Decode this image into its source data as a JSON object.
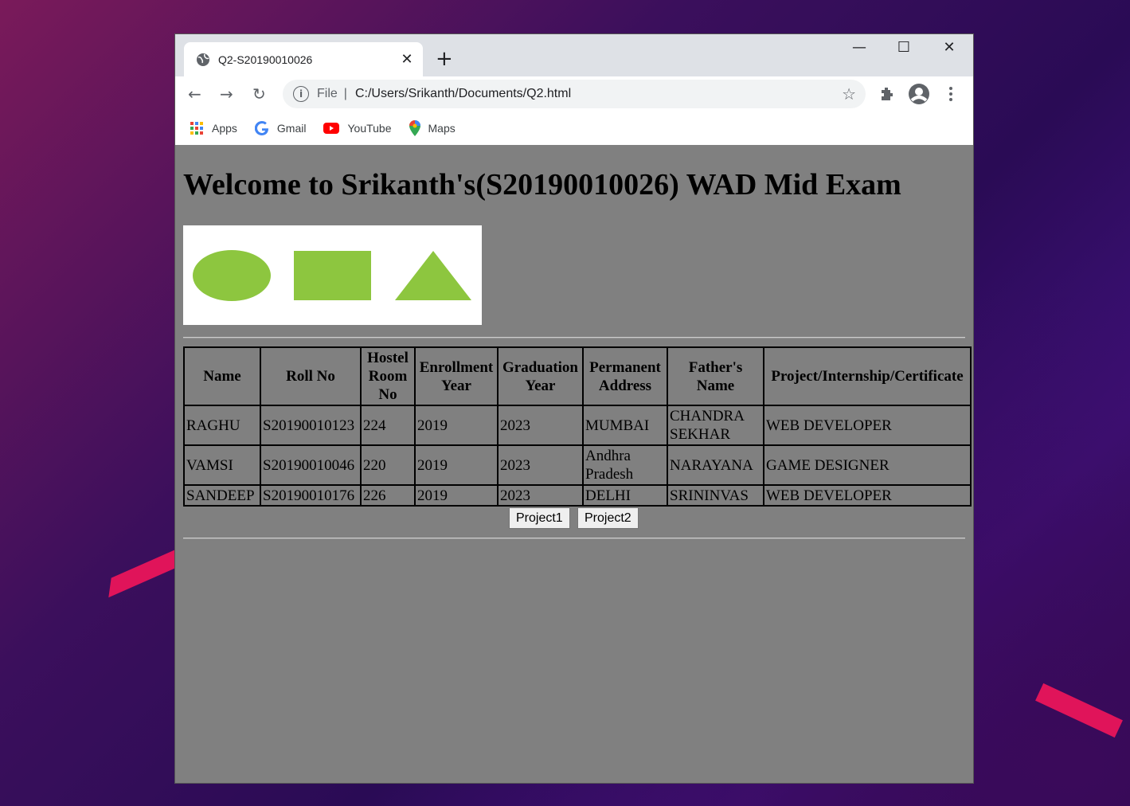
{
  "browser": {
    "tab_title": "Q2-S20190010026",
    "tab_close": "✕",
    "new_tab": "+",
    "window_controls": {
      "minimize": "—",
      "maximize": "☐",
      "close": "✕"
    },
    "nav": {
      "back": "←",
      "forward": "→",
      "reload": "↻"
    },
    "address": {
      "info_glyph": "i",
      "scheme": "File",
      "separator": "|",
      "url": "C:/Users/Srikanth/Documents/Q2.html"
    },
    "bookmarks": [
      {
        "label": "Apps",
        "icon": "apps-grid-icon"
      },
      {
        "label": "Gmail",
        "icon": "google-icon"
      },
      {
        "label": "YouTube",
        "icon": "youtube-icon"
      },
      {
        "label": "Maps",
        "icon": "maps-pin-icon"
      }
    ],
    "colors": {
      "page_bg": "#808080",
      "shape_green": "#8dc63f",
      "chrome_bar": "#dee1e6"
    }
  },
  "page": {
    "heading": "Welcome to Srikanth's(S20190010026) WAD Mid Exam",
    "shapes": [
      "circle",
      "rectangle",
      "triangle"
    ],
    "table": {
      "headers": [
        "Name",
        "Roll No",
        "Hostel Room No",
        "Enrollment Year",
        "Graduation Year",
        "Permanent Address",
        "Father's Name",
        "Project/Internship/Certificate"
      ],
      "rows": [
        [
          "RAGHU",
          "S20190010123",
          "224",
          "2019",
          "2023",
          "MUMBAI",
          "CHANDRA SEKHAR",
          "WEB DEVELOPER"
        ],
        [
          "VAMSI",
          "S20190010046",
          "220",
          "2019",
          "2023",
          "Andhra Pradesh",
          "NARAYANA",
          "GAME DESIGNER"
        ],
        [
          "SANDEEP",
          "S20190010176",
          "226",
          "2019",
          "2023",
          "DELHI",
          "SRININVAS",
          "WEB DEVELOPER"
        ]
      ]
    },
    "buttons": {
      "project1": "Project1",
      "project2": "Project2"
    }
  }
}
